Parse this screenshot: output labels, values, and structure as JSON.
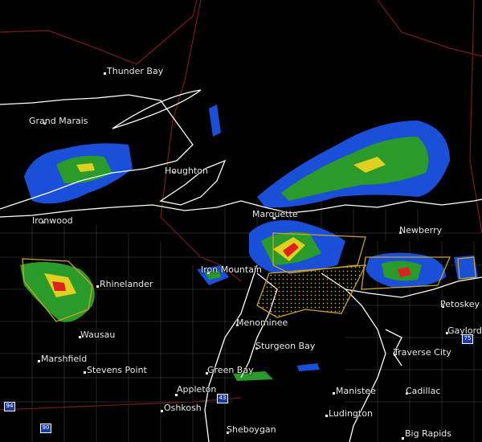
{
  "map": {
    "type": "radar-warning-map",
    "colors": {
      "background": "#000000",
      "coastline": "#ffffff",
      "county_lines": "#3a3a3a",
      "state_lines": "#7a1a1a",
      "warning_polygon": "#c9a227",
      "watch_hatch": "#c9a227",
      "radar_light": "#2a9a2a",
      "radar_mid": "#1a4fd8",
      "radar_heavy": "#e0d020",
      "radar_severe": "#e02020"
    },
    "cities": [
      {
        "id": "thunder-bay",
        "name": "Thunder Bay"
      },
      {
        "id": "grand-marais",
        "name": "Grand Marais"
      },
      {
        "id": "houghton",
        "name": "Houghton"
      },
      {
        "id": "ironwood",
        "name": "Ironwood"
      },
      {
        "id": "marquette",
        "name": "Marquette"
      },
      {
        "id": "newberry",
        "name": "Newberry"
      },
      {
        "id": "iron-mountain",
        "name": "Iron Mountain"
      },
      {
        "id": "rhinelander",
        "name": "Rhinelander"
      },
      {
        "id": "petoskey",
        "name": "Petoskey"
      },
      {
        "id": "wausau",
        "name": "Wausau"
      },
      {
        "id": "menominee",
        "name": "Menominee"
      },
      {
        "id": "gaylord",
        "name": "Gaylord"
      },
      {
        "id": "marshfield",
        "name": "Marshfield"
      },
      {
        "id": "sturgeon-bay",
        "name": "Sturgeon Bay"
      },
      {
        "id": "traverse-city",
        "name": "Traverse City"
      },
      {
        "id": "stevens-point",
        "name": "Stevens Point"
      },
      {
        "id": "green-bay",
        "name": "Green Bay"
      },
      {
        "id": "appleton",
        "name": "Appleton"
      },
      {
        "id": "manistee",
        "name": "Manistee"
      },
      {
        "id": "cadillac",
        "name": "Cadillac"
      },
      {
        "id": "oshkosh",
        "name": "Oshkosh"
      },
      {
        "id": "ludington",
        "name": "Ludington"
      },
      {
        "id": "sheboygan",
        "name": "Sheboygan"
      },
      {
        "id": "big-rapids",
        "name": "Big Rapids"
      }
    ],
    "highway_shields": [
      {
        "id": "i-75",
        "label": "75"
      },
      {
        "id": "i-43",
        "label": "43"
      },
      {
        "id": "i-94",
        "label": "94"
      },
      {
        "id": "i-90",
        "label": "90"
      }
    ]
  }
}
